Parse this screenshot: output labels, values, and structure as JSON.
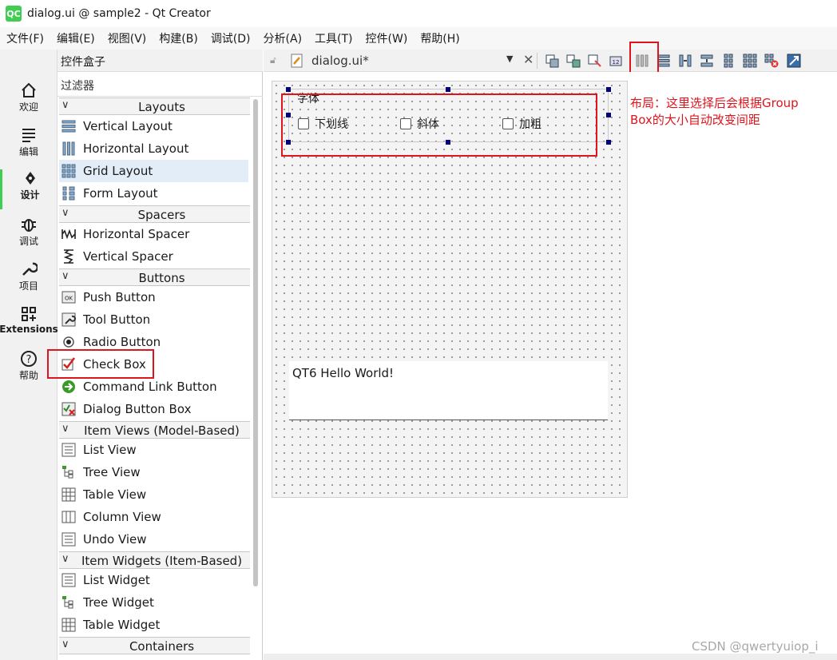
{
  "window": {
    "title": "dialog.ui @ sample2 - Qt Creator",
    "app_icon": "QC",
    "accent": "#41cd52"
  },
  "menubar": [
    "文件(F)",
    "编辑(E)",
    "视图(V)",
    "构建(B)",
    "调试(D)",
    "分析(A)",
    "工具(T)",
    "控件(W)",
    "帮助(H)"
  ],
  "modes": [
    {
      "label": "欢迎",
      "icon": "home-icon"
    },
    {
      "label": "编辑",
      "icon": "document-icon"
    },
    {
      "label": "设计",
      "icon": "pen-icon"
    },
    {
      "label": "调试",
      "icon": "bug-icon"
    },
    {
      "label": "项目",
      "icon": "wrench-icon"
    },
    {
      "label": "Extensions",
      "icon": "extensions-icon"
    },
    {
      "label": "帮助",
      "icon": "help-icon"
    }
  ],
  "widgetbox": {
    "title": "控件盒子",
    "filter_placeholder": "过滤器",
    "categories": [
      "Layouts",
      "Spacers",
      "Buttons",
      "Item Views (Model-Based)",
      "Item Widgets (Item-Based)",
      "Containers"
    ],
    "items": [
      "Vertical Layout",
      "Horizontal Layout",
      "Grid Layout",
      "Form Layout",
      "Horizontal Spacer",
      "Vertical Spacer",
      "Push Button",
      "Tool Button",
      "Radio Button",
      "Check Box",
      "Command Link Button",
      "Dialog Button Box",
      "List View",
      "Tree View",
      "Table View",
      "Column View",
      "Undo View",
      "List Widget",
      "Tree Widget",
      "Table Widget"
    ],
    "push_icon_text": "OK"
  },
  "editor": {
    "tab_label": "dialog.ui*"
  },
  "form": {
    "groupbox_title": "字体",
    "checkboxes": [
      "下划线",
      "斜体",
      "加粗"
    ],
    "text_edit": "QT6 Hello World!"
  },
  "annotation": "布局：这里选择后会根据Group Box的大小自动改变间距",
  "watermark": "CSDN @qwertyuiop_i",
  "colors": {
    "highlight_red": "#e0141c",
    "handle": "#00007f",
    "selection": "#e3edf8"
  }
}
